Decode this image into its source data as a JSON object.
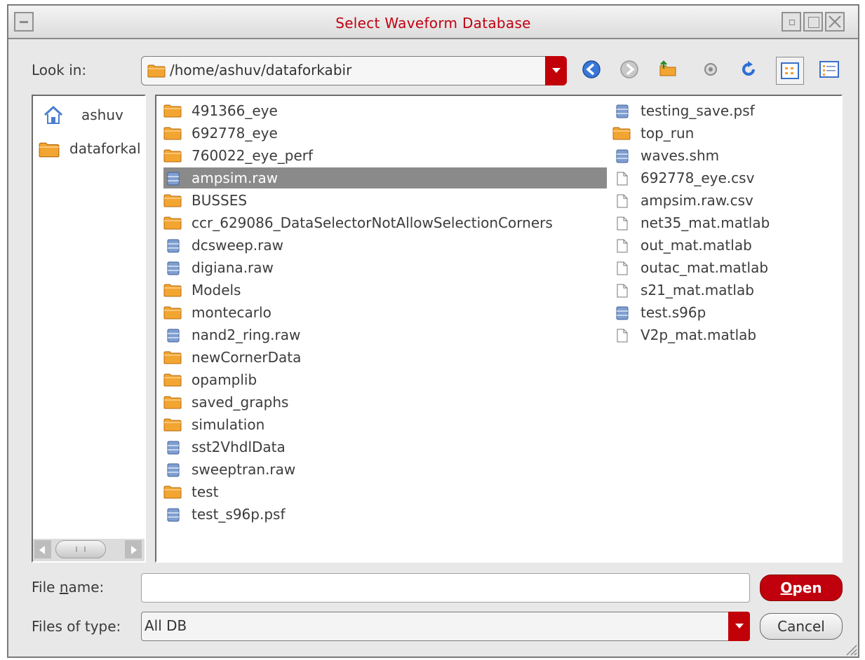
{
  "window": {
    "title": "Select Waveform Database"
  },
  "look_in": {
    "label": "Look in:",
    "path": "/home/ashuv/dataforkabir"
  },
  "toolbar_icons": [
    "back-icon",
    "forward-icon",
    "up-folder-icon",
    "home-icon",
    "refresh-icon",
    "list-view-icon",
    "details-view-icon"
  ],
  "places": [
    {
      "label": "ashuv",
      "icon": "home-icon"
    },
    {
      "label": "dataforkal",
      "icon": "folder-icon"
    }
  ],
  "files_col1": [
    {
      "name": "491366_eye",
      "type": "folder"
    },
    {
      "name": "692778_eye",
      "type": "folder"
    },
    {
      "name": "760022_eye_perf",
      "type": "folder"
    },
    {
      "name": "ampsim.raw",
      "type": "db",
      "selected": true
    },
    {
      "name": "BUSSES",
      "type": "folder"
    },
    {
      "name": "ccr_629086_DataSelectorNotAllowSelectionCorners",
      "type": "folder"
    },
    {
      "name": "dcsweep.raw",
      "type": "db"
    },
    {
      "name": "digiana.raw",
      "type": "db"
    },
    {
      "name": "Models",
      "type": "folder"
    },
    {
      "name": "montecarlo",
      "type": "folder"
    },
    {
      "name": "nand2_ring.raw",
      "type": "db"
    },
    {
      "name": "newCornerData",
      "type": "folder"
    },
    {
      "name": "opamplib",
      "type": "folder"
    },
    {
      "name": "saved_graphs",
      "type": "folder"
    },
    {
      "name": "simulation",
      "type": "folder"
    },
    {
      "name": "sst2VhdlData",
      "type": "db"
    },
    {
      "name": "sweeptran.raw",
      "type": "db"
    },
    {
      "name": "test",
      "type": "folder"
    },
    {
      "name": "test_s96p.psf",
      "type": "db"
    }
  ],
  "files_col2": [
    {
      "name": "testing_save.psf",
      "type": "db"
    },
    {
      "name": "top_run",
      "type": "folder"
    },
    {
      "name": "waves.shm",
      "type": "db"
    },
    {
      "name": "692778_eye.csv",
      "type": "file"
    },
    {
      "name": "ampsim.raw.csv",
      "type": "file"
    },
    {
      "name": "net35_mat.matlab",
      "type": "file"
    },
    {
      "name": "out_mat.matlab",
      "type": "file"
    },
    {
      "name": "outac_mat.matlab",
      "type": "file"
    },
    {
      "name": "s21_mat.matlab",
      "type": "file"
    },
    {
      "name": "test.s96p",
      "type": "db"
    },
    {
      "name": "V2p_mat.matlab",
      "type": "file"
    }
  ],
  "file_name": {
    "label_pre": "File ",
    "label_mnemonic": "n",
    "label_post": "ame:",
    "value": ""
  },
  "file_type": {
    "label": "Files of type:",
    "value": "All DB"
  },
  "buttons": {
    "open_mnemonic": "O",
    "open_rest": "pen",
    "cancel": "Cancel"
  }
}
